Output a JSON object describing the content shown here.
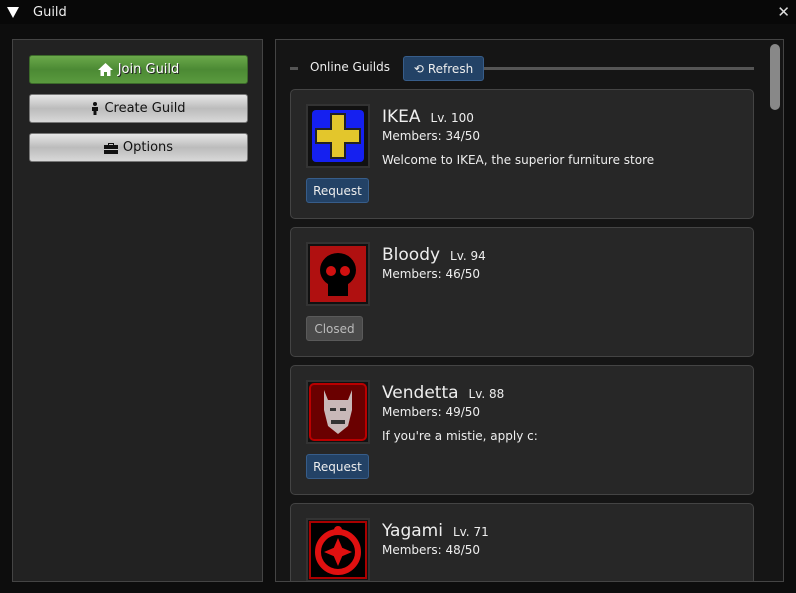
{
  "window": {
    "title": "Guild"
  },
  "sidebar": {
    "buttons": [
      {
        "label": "Join Guild",
        "icon": "home-icon"
      },
      {
        "label": "Create Guild",
        "icon": "person-icon"
      },
      {
        "label": "Options",
        "icon": "toolbox-icon"
      }
    ]
  },
  "main": {
    "section_label": "Online Guilds",
    "refresh_label": "Refresh",
    "guilds": [
      {
        "name": "IKEA",
        "level": "Lv. 100",
        "members": "Members: 34/50",
        "description": "Welcome to IKEA, the superior furniture store",
        "action": "Request"
      },
      {
        "name": "Bloody",
        "level": "Lv. 94",
        "members": "Members: 46/50",
        "description": "",
        "action": "Closed"
      },
      {
        "name": "Vendetta",
        "level": "Lv. 88",
        "members": "Members: 49/50",
        "description": "If you're a mistie, apply c:",
        "action": "Request"
      },
      {
        "name": "Yagami",
        "level": "Lv. 71",
        "members": "Members: 48/50",
        "description": "",
        "action": ""
      }
    ]
  },
  "colors": {
    "accent_green": "#5a9a3e",
    "button_blue": "#234266"
  }
}
